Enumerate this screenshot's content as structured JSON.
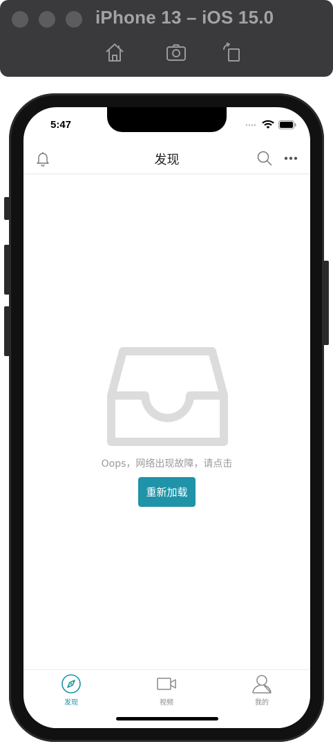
{
  "simulator": {
    "title": "iPhone 13 – iOS 15.0",
    "tools": [
      "home-icon",
      "screenshot-icon",
      "rotate-icon"
    ]
  },
  "status_bar": {
    "time": "5:47"
  },
  "navbar": {
    "title": "发现"
  },
  "empty_state": {
    "message": "Oops，网络出现故障，请点击",
    "reload_label": "重新加载"
  },
  "tabs": [
    {
      "label": "发现",
      "icon": "compass-icon",
      "active": true
    },
    {
      "label": "视频",
      "icon": "video-icon",
      "active": false
    },
    {
      "label": "我的",
      "icon": "user-icon",
      "active": false
    }
  ],
  "colors": {
    "accent": "#1f93a8",
    "inactive_icon": "#8a8a8a",
    "empty_illustration": "#dcdcdc"
  }
}
